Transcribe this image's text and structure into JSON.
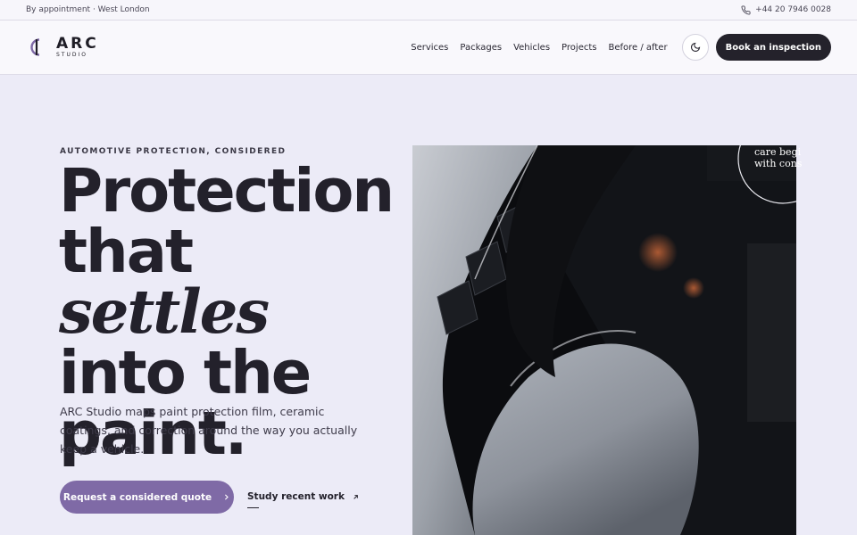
{
  "topbar": {
    "availability": "By appointment · West London",
    "phone": "+44 20 7946 0028",
    "phone_icon": "phone-icon"
  },
  "brand": {
    "name": "ARC",
    "sub": "STUDIO",
    "mark_icon": "arc-logo-icon"
  },
  "nav": {
    "items": [
      "Services",
      "Packages",
      "Vehicles",
      "Projects",
      "Before / after"
    ],
    "theme_icon": "moon-icon",
    "book_label": "Book an inspection"
  },
  "hero": {
    "eyebrow": "AUTOMOTIVE PROTECTION, CONSIDERED",
    "headline_1": "Protection",
    "headline_2a": "that ",
    "headline_2b": "settles",
    "headline_3": "into the",
    "headline_4": "paint.",
    "lede": "ARC Studio maps paint protection film, ceramic coatings, and correction around the way you actually keep a vehicle.",
    "cta_label": "Request a considered quote",
    "cta_icon": "chevron-right-icon",
    "secondary_label": "Study recent work",
    "secondary_icon": "arrow-up-right-icon"
  },
  "photo": {
    "badge_line_1": "care begi",
    "badge_line_2": "with cons"
  },
  "colors": {
    "background": "#ecebf7",
    "accent": "#7f6aa6",
    "dark": "#24222b"
  }
}
